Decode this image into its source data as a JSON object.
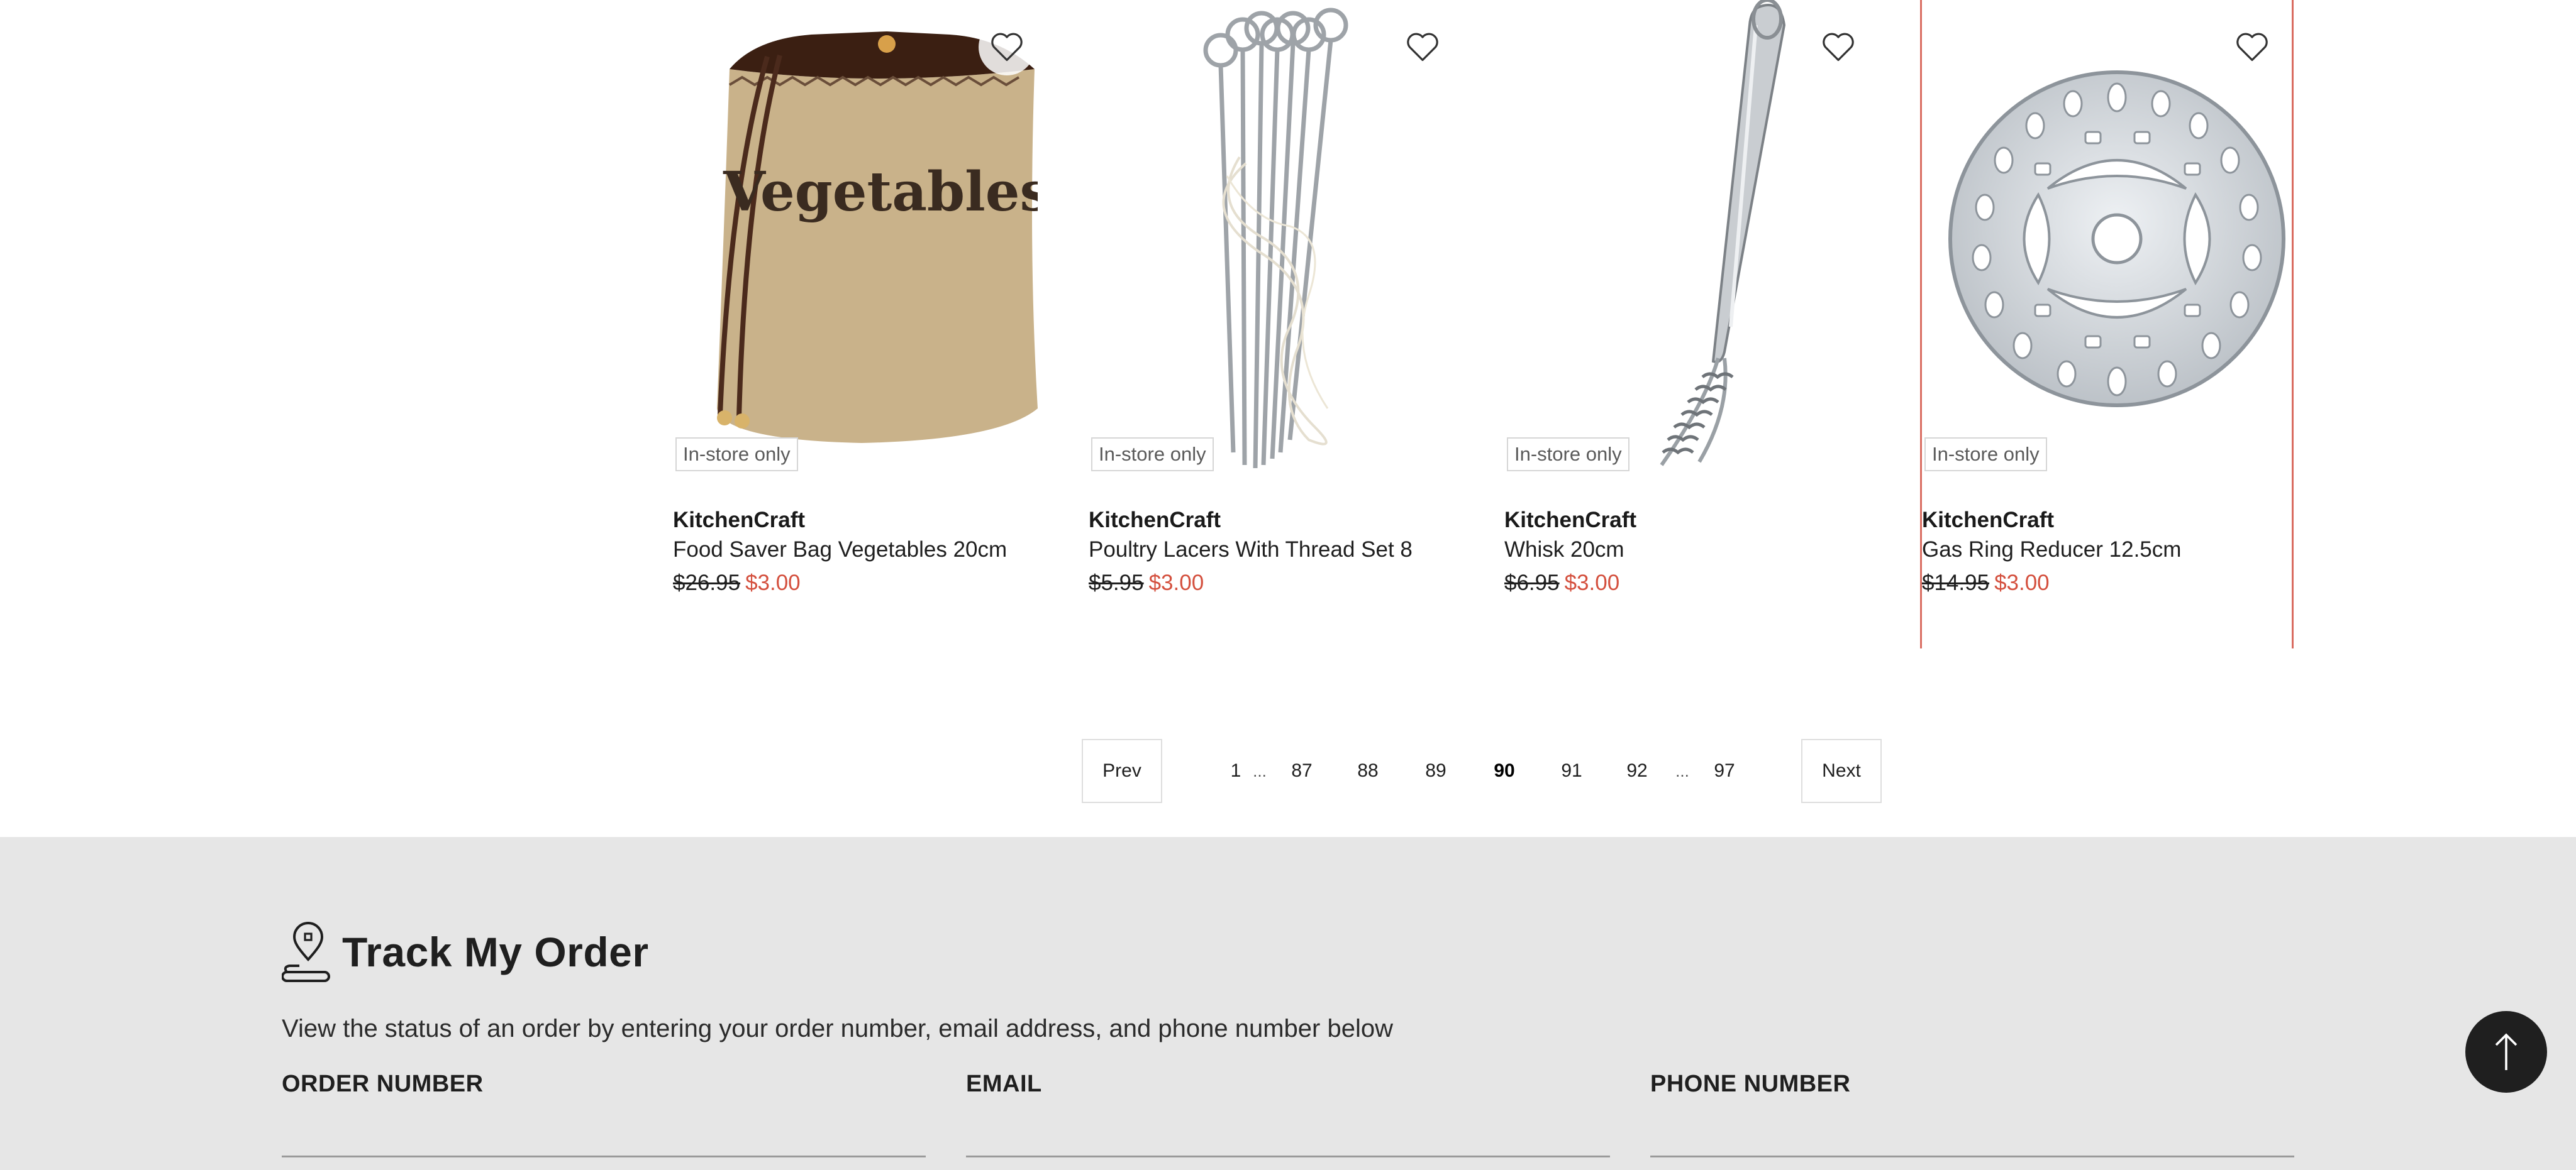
{
  "products": [
    {
      "badge": "In-store only",
      "brand": "KitchenCraft",
      "name": "Food Saver Bag Vegetables 20cm",
      "was_price": "$26.95",
      "now_price": "$3.00",
      "image_text": "Vegetables"
    },
    {
      "badge": "In-store only",
      "brand": "KitchenCraft",
      "name": "Poultry Lacers With Thread Set 8",
      "was_price": "$5.95",
      "now_price": "$3.00"
    },
    {
      "badge": "In-store only",
      "brand": "KitchenCraft",
      "name": "Whisk 20cm",
      "was_price": "$6.95",
      "now_price": "$3.00"
    },
    {
      "badge": "In-store only",
      "brand": "KitchenCraft",
      "name": "Gas Ring Reducer 12.5cm",
      "was_price": "$14.95",
      "now_price": "$3.00"
    }
  ],
  "pagination": {
    "prev": "Prev",
    "next": "Next",
    "first": "1",
    "ellipsis": "...",
    "pages": [
      "87",
      "88",
      "89",
      "90",
      "91",
      "92"
    ],
    "current": "90",
    "last": "97"
  },
  "track_order": {
    "title": "Track My Order",
    "description": "View the status of an order by entering your order number, email address, and phone number below",
    "fields": {
      "order_number": {
        "label": "ORDER NUMBER",
        "value": ""
      },
      "email": {
        "label": "EMAIL",
        "value": ""
      },
      "phone": {
        "label": "PHONE NUMBER",
        "value": ""
      }
    }
  },
  "colors": {
    "sale_price": "#d4503e",
    "highlight_border": "#d96c61",
    "footer_bg": "#e6e6e6"
  },
  "icons": {
    "wishlist": "heart-outline-icon",
    "track": "location-pin-icon",
    "back_to_top": "arrow-up-icon"
  }
}
